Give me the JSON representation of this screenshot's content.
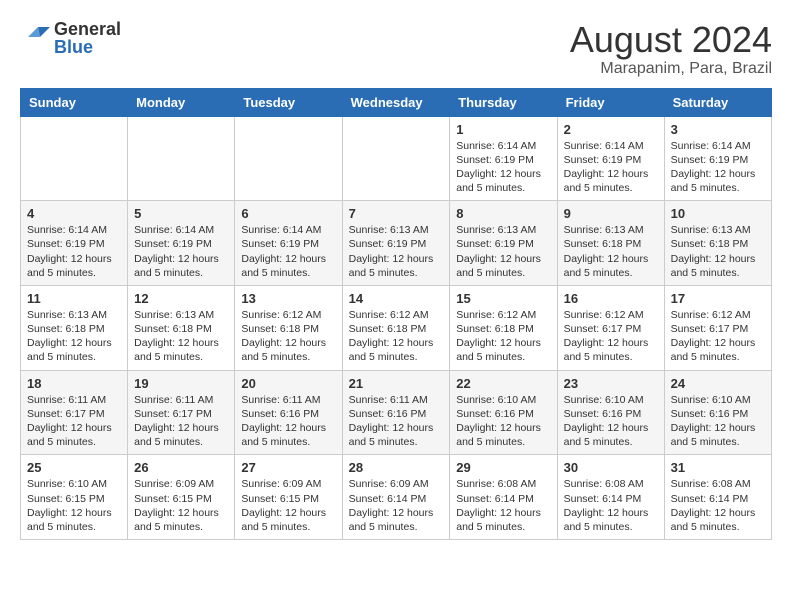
{
  "logo": {
    "general": "General",
    "blue": "Blue"
  },
  "header": {
    "month_year": "August 2024",
    "location": "Marapanim, Para, Brazil"
  },
  "days_of_week": [
    "Sunday",
    "Monday",
    "Tuesday",
    "Wednesday",
    "Thursday",
    "Friday",
    "Saturday"
  ],
  "weeks": [
    [
      {
        "day": "",
        "info": ""
      },
      {
        "day": "",
        "info": ""
      },
      {
        "day": "",
        "info": ""
      },
      {
        "day": "",
        "info": ""
      },
      {
        "day": "1",
        "info": "Sunrise: 6:14 AM\nSunset: 6:19 PM\nDaylight: 12 hours and 5 minutes."
      },
      {
        "day": "2",
        "info": "Sunrise: 6:14 AM\nSunset: 6:19 PM\nDaylight: 12 hours and 5 minutes."
      },
      {
        "day": "3",
        "info": "Sunrise: 6:14 AM\nSunset: 6:19 PM\nDaylight: 12 hours and 5 minutes."
      }
    ],
    [
      {
        "day": "4",
        "info": "Sunrise: 6:14 AM\nSunset: 6:19 PM\nDaylight: 12 hours and 5 minutes."
      },
      {
        "day": "5",
        "info": "Sunrise: 6:14 AM\nSunset: 6:19 PM\nDaylight: 12 hours and 5 minutes."
      },
      {
        "day": "6",
        "info": "Sunrise: 6:14 AM\nSunset: 6:19 PM\nDaylight: 12 hours and 5 minutes."
      },
      {
        "day": "7",
        "info": "Sunrise: 6:13 AM\nSunset: 6:19 PM\nDaylight: 12 hours and 5 minutes."
      },
      {
        "day": "8",
        "info": "Sunrise: 6:13 AM\nSunset: 6:19 PM\nDaylight: 12 hours and 5 minutes."
      },
      {
        "day": "9",
        "info": "Sunrise: 6:13 AM\nSunset: 6:18 PM\nDaylight: 12 hours and 5 minutes."
      },
      {
        "day": "10",
        "info": "Sunrise: 6:13 AM\nSunset: 6:18 PM\nDaylight: 12 hours and 5 minutes."
      }
    ],
    [
      {
        "day": "11",
        "info": "Sunrise: 6:13 AM\nSunset: 6:18 PM\nDaylight: 12 hours and 5 minutes."
      },
      {
        "day": "12",
        "info": "Sunrise: 6:13 AM\nSunset: 6:18 PM\nDaylight: 12 hours and 5 minutes."
      },
      {
        "day": "13",
        "info": "Sunrise: 6:12 AM\nSunset: 6:18 PM\nDaylight: 12 hours and 5 minutes."
      },
      {
        "day": "14",
        "info": "Sunrise: 6:12 AM\nSunset: 6:18 PM\nDaylight: 12 hours and 5 minutes."
      },
      {
        "day": "15",
        "info": "Sunrise: 6:12 AM\nSunset: 6:18 PM\nDaylight: 12 hours and 5 minutes."
      },
      {
        "day": "16",
        "info": "Sunrise: 6:12 AM\nSunset: 6:17 PM\nDaylight: 12 hours and 5 minutes."
      },
      {
        "day": "17",
        "info": "Sunrise: 6:12 AM\nSunset: 6:17 PM\nDaylight: 12 hours and 5 minutes."
      }
    ],
    [
      {
        "day": "18",
        "info": "Sunrise: 6:11 AM\nSunset: 6:17 PM\nDaylight: 12 hours and 5 minutes."
      },
      {
        "day": "19",
        "info": "Sunrise: 6:11 AM\nSunset: 6:17 PM\nDaylight: 12 hours and 5 minutes."
      },
      {
        "day": "20",
        "info": "Sunrise: 6:11 AM\nSunset: 6:16 PM\nDaylight: 12 hours and 5 minutes."
      },
      {
        "day": "21",
        "info": "Sunrise: 6:11 AM\nSunset: 6:16 PM\nDaylight: 12 hours and 5 minutes."
      },
      {
        "day": "22",
        "info": "Sunrise: 6:10 AM\nSunset: 6:16 PM\nDaylight: 12 hours and 5 minutes."
      },
      {
        "day": "23",
        "info": "Sunrise: 6:10 AM\nSunset: 6:16 PM\nDaylight: 12 hours and 5 minutes."
      },
      {
        "day": "24",
        "info": "Sunrise: 6:10 AM\nSunset: 6:16 PM\nDaylight: 12 hours and 5 minutes."
      }
    ],
    [
      {
        "day": "25",
        "info": "Sunrise: 6:10 AM\nSunset: 6:15 PM\nDaylight: 12 hours and 5 minutes."
      },
      {
        "day": "26",
        "info": "Sunrise: 6:09 AM\nSunset: 6:15 PM\nDaylight: 12 hours and 5 minutes."
      },
      {
        "day": "27",
        "info": "Sunrise: 6:09 AM\nSunset: 6:15 PM\nDaylight: 12 hours and 5 minutes."
      },
      {
        "day": "28",
        "info": "Sunrise: 6:09 AM\nSunset: 6:14 PM\nDaylight: 12 hours and 5 minutes."
      },
      {
        "day": "29",
        "info": "Sunrise: 6:08 AM\nSunset: 6:14 PM\nDaylight: 12 hours and 5 minutes."
      },
      {
        "day": "30",
        "info": "Sunrise: 6:08 AM\nSunset: 6:14 PM\nDaylight: 12 hours and 5 minutes."
      },
      {
        "day": "31",
        "info": "Sunrise: 6:08 AM\nSunset: 6:14 PM\nDaylight: 12 hours and 5 minutes."
      }
    ]
  ]
}
